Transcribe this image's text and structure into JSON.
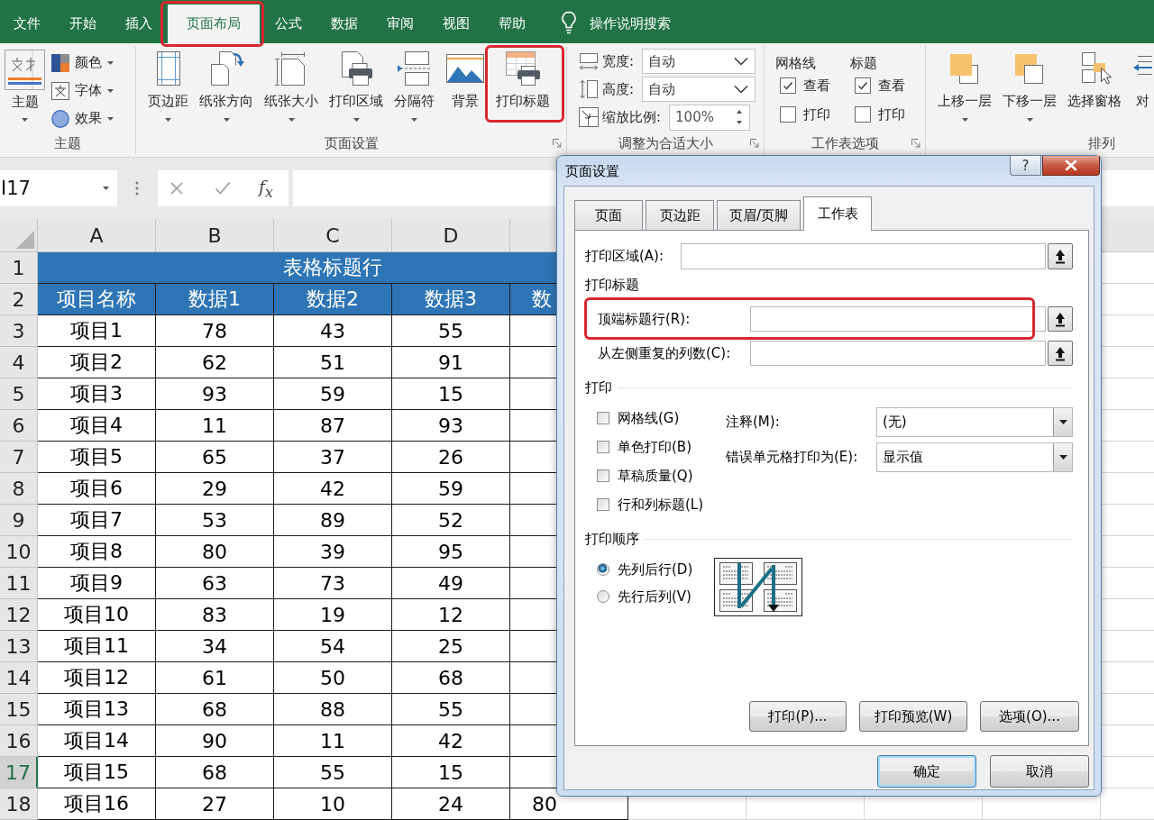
{
  "tabs": [
    {
      "label": "文件",
      "selected": false,
      "highlighted": false
    },
    {
      "label": "开始",
      "selected": false,
      "highlighted": false
    },
    {
      "label": "插入",
      "selected": false,
      "highlighted": false
    },
    {
      "label": "页面布局",
      "selected": true,
      "highlighted": true
    },
    {
      "label": "公式",
      "selected": false,
      "highlighted": false
    },
    {
      "label": "数据",
      "selected": false,
      "highlighted": false
    },
    {
      "label": "审阅",
      "selected": false,
      "highlighted": false
    },
    {
      "label": "视图",
      "selected": false,
      "highlighted": false
    },
    {
      "label": "帮助",
      "selected": false,
      "highlighted": false
    }
  ],
  "tell_me": {
    "label": "操作说明搜索"
  },
  "ribbon": {
    "groups": [
      {
        "kind": "themes",
        "label": "主题",
        "launcher": false,
        "main": {
          "label": "主题"
        },
        "items": [
          {
            "label": "颜色"
          },
          {
            "label": "字体"
          },
          {
            "label": "效果"
          }
        ]
      },
      {
        "kind": "large_buttons",
        "label": "页面设置",
        "launcher": true,
        "buttons": [
          {
            "label": "页边距",
            "dropdown": true,
            "highlighted": false
          },
          {
            "label": "纸张方向",
            "dropdown": true,
            "highlighted": false
          },
          {
            "label": "纸张大小",
            "dropdown": true,
            "highlighted": false
          },
          {
            "label": "打印区域",
            "dropdown": true,
            "highlighted": false
          },
          {
            "label": "分隔符",
            "dropdown": true,
            "highlighted": false
          },
          {
            "label": "背景",
            "dropdown": false,
            "highlighted": false
          },
          {
            "label": "打印标题",
            "dropdown": false,
            "highlighted": true
          }
        ]
      },
      {
        "kind": "scale",
        "label": "调整为合适大小",
        "launcher": true,
        "fields": [
          {
            "kind": "select",
            "label": "宽度:",
            "value": "自动"
          },
          {
            "kind": "select",
            "label": "高度:",
            "value": "自动"
          },
          {
            "kind": "spinner",
            "label": "缩放比例:",
            "value": "100%"
          }
        ]
      },
      {
        "kind": "sheet_options",
        "label": "工作表选项",
        "launcher": true,
        "columns": [
          {
            "heading": "网格线",
            "options": [
              {
                "label": "查看",
                "checked": true
              },
              {
                "label": "打印",
                "checked": false
              }
            ]
          },
          {
            "heading": "标题",
            "options": [
              {
                "label": "查看",
                "checked": true
              },
              {
                "label": "打印",
                "checked": false
              }
            ]
          }
        ]
      },
      {
        "kind": "large_buttons",
        "label": "排列",
        "launcher": false,
        "buttons": [
          {
            "label": "上移一层",
            "dropdown": true,
            "highlighted": false
          },
          {
            "label": "下移一层",
            "dropdown": true,
            "highlighted": false
          },
          {
            "label": "选择窗格",
            "dropdown": false,
            "highlighted": false
          },
          {
            "label": "对",
            "dropdown": false,
            "highlighted": false
          }
        ]
      }
    ]
  },
  "formula_bar": {
    "name_box": "I17",
    "function_label": "f$_{x}$"
  },
  "sheet": {
    "columns": [
      "A",
      "B",
      "C",
      "D"
    ],
    "rows": [
      {
        "number": "1",
        "selected": false,
        "kind": "title",
        "cells": [
          {
            "text": "表格标题行",
            "colspan": 5
          }
        ]
      },
      {
        "number": "2",
        "selected": false,
        "kind": "header",
        "cells": [
          "项目名称",
          "数据1",
          "数据2",
          "数据3",
          "数"
        ]
      },
      {
        "number": "3",
        "selected": false,
        "kind": "data",
        "cells": [
          "项目1",
          "78",
          "43",
          "55"
        ]
      },
      {
        "number": "4",
        "selected": false,
        "kind": "data",
        "cells": [
          "项目2",
          "62",
          "51",
          "91"
        ]
      },
      {
        "number": "5",
        "selected": false,
        "kind": "data",
        "cells": [
          "项目3",
          "93",
          "59",
          "15"
        ]
      },
      {
        "number": "6",
        "selected": false,
        "kind": "data",
        "cells": [
          "项目4",
          "11",
          "87",
          "93"
        ]
      },
      {
        "number": "7",
        "selected": false,
        "kind": "data",
        "cells": [
          "项目5",
          "65",
          "37",
          "26"
        ]
      },
      {
        "number": "8",
        "selected": false,
        "kind": "data",
        "cells": [
          "项目6",
          "29",
          "42",
          "59"
        ]
      },
      {
        "number": "9",
        "selected": false,
        "kind": "data",
        "cells": [
          "项目7",
          "53",
          "89",
          "52"
        ]
      },
      {
        "number": "10",
        "selected": false,
        "kind": "data",
        "cells": [
          "项目8",
          "80",
          "39",
          "95"
        ]
      },
      {
        "number": "11",
        "selected": false,
        "kind": "data",
        "cells": [
          "项目9",
          "63",
          "73",
          "49"
        ]
      },
      {
        "number": "12",
        "selected": false,
        "kind": "data",
        "cells": [
          "项目10",
          "83",
          "19",
          "12"
        ]
      },
      {
        "number": "13",
        "selected": false,
        "kind": "data",
        "cells": [
          "项目11",
          "34",
          "54",
          "25"
        ]
      },
      {
        "number": "14",
        "selected": false,
        "kind": "data",
        "cells": [
          "项目12",
          "61",
          "50",
          "68"
        ]
      },
      {
        "number": "15",
        "selected": false,
        "kind": "data",
        "cells": [
          "项目13",
          "68",
          "88",
          "55"
        ]
      },
      {
        "number": "16",
        "selected": false,
        "kind": "data",
        "cells": [
          "项目14",
          "90",
          "11",
          "42"
        ]
      },
      {
        "number": "17",
        "selected": true,
        "kind": "data",
        "cells": [
          "项目15",
          "68",
          "55",
          "15"
        ]
      },
      {
        "number": "18",
        "selected": false,
        "kind": "data",
        "cells": [
          "项目16",
          "27",
          "10",
          "24",
          "80"
        ]
      }
    ]
  },
  "dialog": {
    "title": "页面设置",
    "help_label": "?",
    "tabs": [
      {
        "label": "页面",
        "selected": false
      },
      {
        "label": "页边距",
        "selected": false
      },
      {
        "label": "页眉/页脚",
        "selected": false
      },
      {
        "label": "工作表",
        "selected": true
      }
    ],
    "print_area": {
      "label": "打印区域(A):"
    },
    "titles_heading": "打印标题",
    "title_fields": [
      {
        "label": "顶端标题行(R):",
        "highlighted": true
      },
      {
        "label": "从左侧重复的列数(C):",
        "highlighted": false
      }
    ],
    "print_heading": "打印",
    "print_options": [
      {
        "label": "网格线(G)",
        "checked": false
      },
      {
        "label": "单色打印(B)",
        "checked": false
      },
      {
        "label": "草稿质量(Q)",
        "checked": false
      },
      {
        "label": "行和列标题(L)",
        "checked": false
      }
    ],
    "selects": [
      {
        "label": "注释(M):",
        "value": "(无)"
      },
      {
        "label": "错误单元格打印为(E):",
        "value": "显示值"
      }
    ],
    "order_heading": "打印顺序",
    "order_options": [
      {
        "label": "先列后行(D)",
        "selected": true
      },
      {
        "label": "先行后列(V)",
        "selected": false
      }
    ],
    "action_buttons": [
      {
        "label": "打印(P)..."
      },
      {
        "label": "打印预览(W)"
      },
      {
        "label": "选项(O)..."
      }
    ],
    "footer_buttons": [
      {
        "label": "确定",
        "default": true
      },
      {
        "label": "取消",
        "default": false
      }
    ]
  }
}
